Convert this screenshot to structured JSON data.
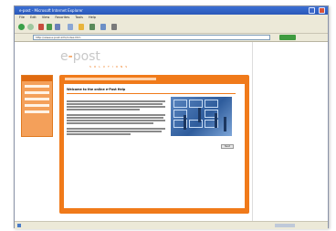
{
  "window": {
    "title": "e-post - Microsoft Internet Explorer"
  },
  "menu": {
    "items": [
      "File",
      "Edit",
      "View",
      "Favorites",
      "Tools",
      "Help"
    ]
  },
  "toolbar": {
    "buttons": [
      "back-icon",
      "forward-icon",
      "stop-icon",
      "refresh-icon",
      "home-icon",
      "search-icon",
      "favorites-icon",
      "history-icon",
      "mail-icon",
      "print-icon"
    ]
  },
  "address": {
    "value": "http://www.e-post.info/index.htm"
  },
  "page": {
    "logo_left": "e",
    "logo_dash": "-",
    "logo_right": "post",
    "tagline": "SOLUTIONS",
    "content_title": "Welcome to the online e-Post Help",
    "next_label": "Next"
  },
  "colors": {
    "accent": "#f07a1a",
    "titlebar": "#2a58b8",
    "chrome": "#ece9d8"
  }
}
